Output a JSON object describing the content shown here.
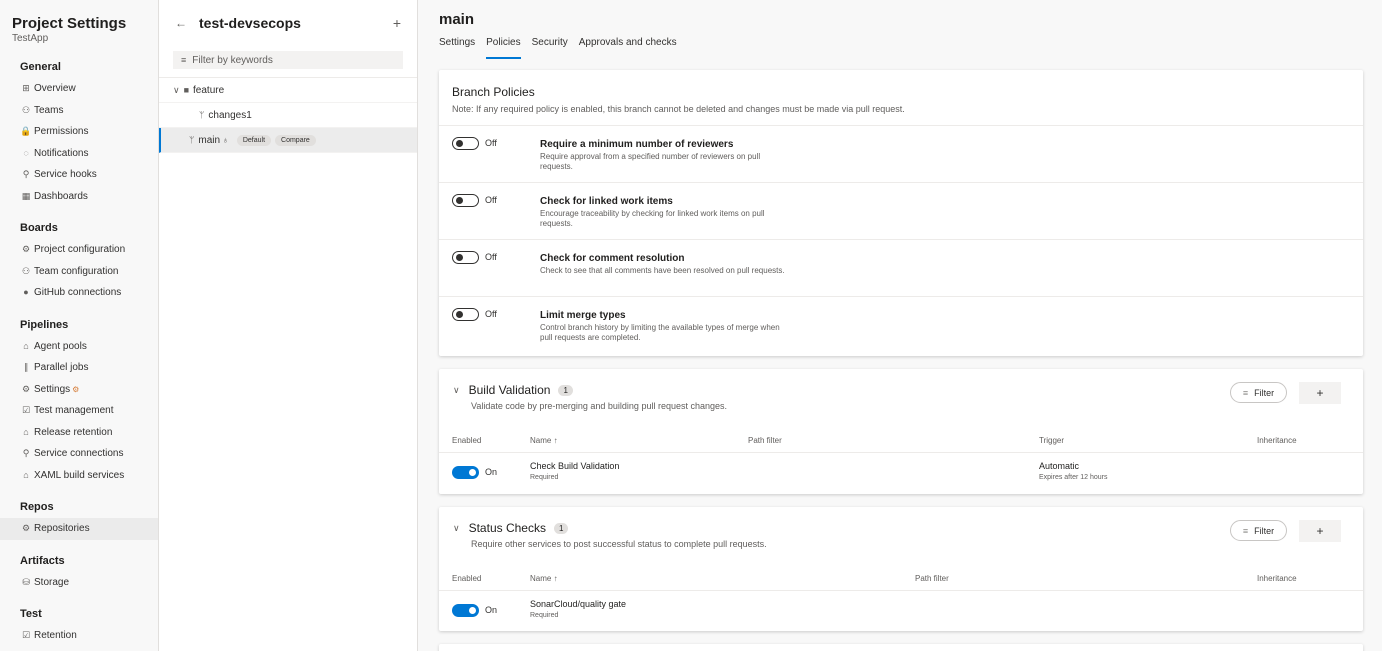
{
  "sidebar": {
    "title": "Project Settings",
    "subtitle": "TestApp",
    "sections": [
      {
        "label": "General",
        "items": [
          {
            "icon": "⊞",
            "label": "Overview"
          },
          {
            "icon": "⚇",
            "label": "Teams"
          },
          {
            "icon": "🔒",
            "label": "Permissions"
          },
          {
            "icon": "◌",
            "label": "Notifications"
          },
          {
            "icon": "⚲",
            "label": "Service hooks"
          },
          {
            "icon": "▦",
            "label": "Dashboards"
          }
        ]
      },
      {
        "label": "Boards",
        "items": [
          {
            "icon": "⚙",
            "label": "Project configuration"
          },
          {
            "icon": "⚇",
            "label": "Team configuration"
          },
          {
            "icon": "●",
            "label": "GitHub connections"
          }
        ]
      },
      {
        "label": "Pipelines",
        "items": [
          {
            "icon": "⌂",
            "label": "Agent pools"
          },
          {
            "icon": "∥",
            "label": "Parallel jobs"
          },
          {
            "icon": "⚙",
            "label": "Settings"
          },
          {
            "icon": "☑",
            "label": "Test management"
          },
          {
            "icon": "⌂",
            "label": "Release retention"
          },
          {
            "icon": "⚲",
            "label": "Service connections"
          },
          {
            "icon": "⌂",
            "label": "XAML build services"
          }
        ]
      },
      {
        "label": "Repos",
        "items": [
          {
            "icon": "⚙",
            "label": "Repositories",
            "active": true
          }
        ]
      },
      {
        "label": "Artifacts",
        "items": [
          {
            "icon": "⛁",
            "label": "Storage"
          }
        ]
      },
      {
        "label": "Test",
        "items": [
          {
            "icon": "☑",
            "label": "Retention"
          }
        ]
      }
    ]
  },
  "tree": {
    "repo_name": "test-devsecops",
    "filter_placeholder": "Filter by keywords",
    "folder": "feature",
    "branch_child": "changes1",
    "branch_main": "main",
    "badge_default": "Default",
    "badge_compare": "Compare"
  },
  "main": {
    "title": "main",
    "tabs": [
      "Settings",
      "Policies",
      "Security",
      "Approvals and checks"
    ],
    "active_tab": "Policies"
  },
  "branch_policies": {
    "title": "Branch Policies",
    "note": "Note: If any required policy is enabled, this branch cannot be deleted and changes must be made via pull request.",
    "off_label": "Off",
    "items": [
      {
        "title": "Require a minimum number of reviewers",
        "desc": "Require approval from a specified number of reviewers on pull requests."
      },
      {
        "title": "Check for linked work items",
        "desc": "Encourage traceability by checking for linked work items on pull requests."
      },
      {
        "title": "Check for comment resolution",
        "desc": "Check to see that all comments have been resolved on pull requests."
      },
      {
        "title": "Limit merge types",
        "desc": "Control branch history by limiting the available types of merge when pull requests are completed."
      }
    ]
  },
  "build_validation": {
    "title": "Build Validation",
    "count": "1",
    "desc": "Validate code by pre-merging and building pull request changes.",
    "filter_label": "Filter",
    "add_label": "+",
    "columns": {
      "enabled": "Enabled",
      "name": "Name ↑",
      "path": "Path filter",
      "trigger": "Trigger",
      "inheritance": "Inheritance"
    },
    "row": {
      "state": "On",
      "name": "Check Build Validation",
      "sub": "Required",
      "trigger": "Automatic",
      "trigger_sub": "Expires after 12 hours"
    }
  },
  "status_checks": {
    "title": "Status Checks",
    "count": "1",
    "desc": "Require other services to post successful status to complete pull requests.",
    "filter_label": "Filter",
    "add_label": "+",
    "columns": {
      "enabled": "Enabled",
      "name": "Name ↑",
      "path": "Path filter",
      "inheritance": "Inheritance"
    },
    "row": {
      "state": "On",
      "name": "SonarCloud/quality gate",
      "sub": "Required"
    }
  }
}
